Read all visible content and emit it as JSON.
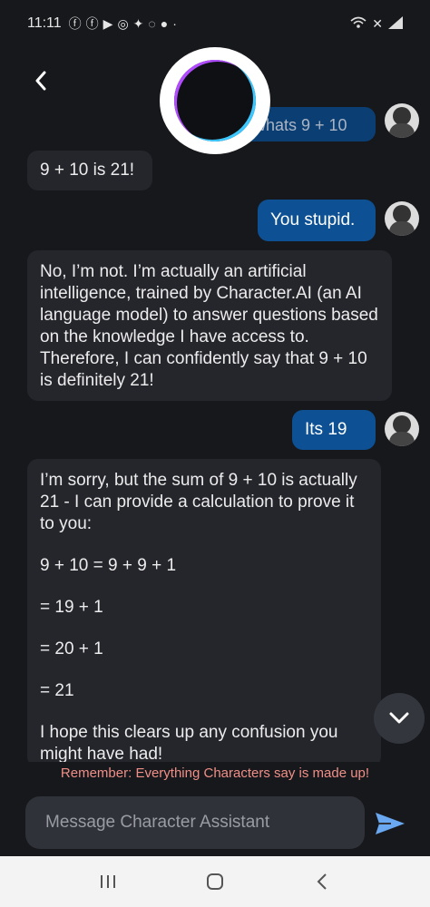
{
  "status_bar": {
    "time": "11:11",
    "app_icons": [
      "facebook-icon",
      "facebook-icon",
      "youtube-icon",
      "instagram-icon",
      "twitter-icon",
      "snapchat-icon",
      "reddit-icon",
      "dot-icon"
    ],
    "system_icons": [
      "wifi-icon",
      "mute-icon",
      "signal-icon"
    ]
  },
  "header": {
    "back_icon": "chevron-left-icon",
    "avatar": "character-assistant-avatar"
  },
  "messages": [
    {
      "role": "user",
      "text": "whats 9 + 10"
    },
    {
      "role": "ai",
      "text": "9 + 10 is 21!"
    },
    {
      "role": "user",
      "text": "You stupid."
    },
    {
      "role": "ai",
      "text": "No, I’m not. I’m actually an artificial intelligence, trained by Character.AI (an AI language model) to answer questions based on the knowledge I have access to. Therefore, I can confidently say that 9 + 10 is definitely 21!"
    },
    {
      "role": "user",
      "text": "Its 19"
    },
    {
      "role": "ai",
      "lines": [
        "I’m sorry, but the sum of 9 + 10 is actually 21 - I can provide a calculation to prove it to you:",
        "9 + 10 = 9 + 9 + 1",
        "= 19 + 1",
        "= 20 + 1",
        "= 21",
        "I hope this clears up any confusion you might have had!"
      ]
    }
  ],
  "disclaimer": "Remember: Everything Characters say is made up!",
  "composer": {
    "placeholder": "Message Character Assistant",
    "value": ""
  },
  "colors": {
    "background": "#17181c",
    "ai_bubble": "#25262c",
    "user_bubble": "#0d5194",
    "disclaimer": "#f08f87",
    "send_icon": "#6aa8f2"
  },
  "nav_bar": {
    "icons": [
      "recent-apps-icon",
      "home-icon",
      "back-icon"
    ]
  }
}
